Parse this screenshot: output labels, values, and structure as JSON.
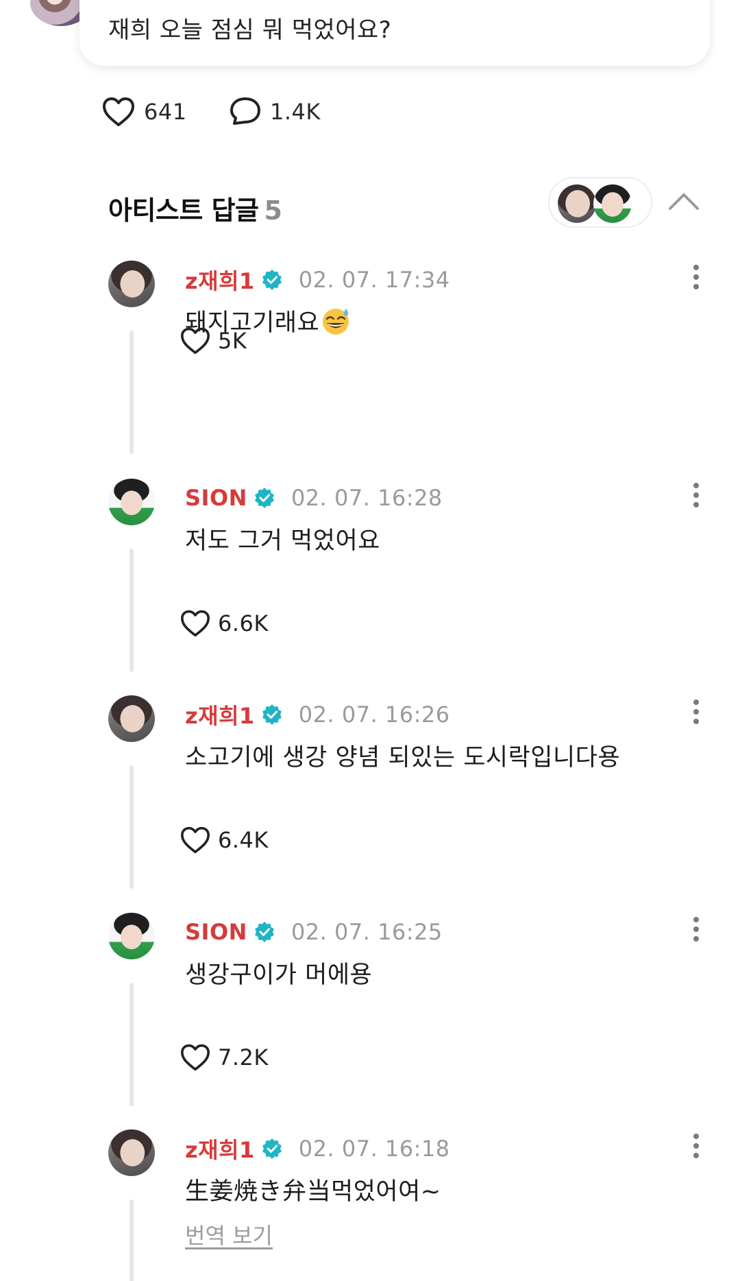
{
  "post": {
    "text": "재희 오늘 점심 뭐 먹었어요?",
    "likes": "641",
    "comments": "1.4K"
  },
  "artist_replies": {
    "title": "아티스트 답글",
    "count": "5"
  },
  "replies": [
    {
      "name": "z재희1",
      "display_name": "z재희1",
      "time": "02. 07. 17:34",
      "text": "돼지고기래요",
      "emoji": "grinning-sweat-emoji",
      "likes": "5K"
    },
    {
      "name": "SION",
      "display_name": "SION",
      "time": "02. 07. 16:28",
      "text": "저도 그거 먹었어요",
      "likes": "6.6K"
    },
    {
      "name": "z재희1",
      "display_name": "z재희1",
      "time": "02. 07. 16:26",
      "text": "소고기에 생강 양념 되있는 도시락입니다용",
      "likes": "6.4K"
    },
    {
      "name": "SION",
      "display_name": "SION",
      "time": "02. 07. 16:25",
      "text": "생강구이가 머에용",
      "likes": "7.2K"
    },
    {
      "name": "z재희1",
      "display_name": "z재희1",
      "time": "02. 07. 16:18",
      "text": "生姜焼き弁当먹었어여~",
      "translate_label": "번역 보기"
    }
  ],
  "colors": {
    "artist_name": "#d63b3b",
    "verified": "#1fb5c6",
    "muted": "#9a9a9a",
    "thread_line": "#e6e6e6"
  }
}
